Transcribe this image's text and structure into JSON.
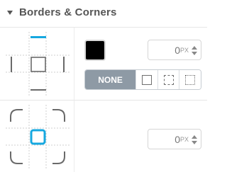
{
  "panel": {
    "title": "Borders & Corners"
  },
  "borders": {
    "color_swatch": "#000000",
    "width": {
      "value": "0",
      "unit": "PX"
    },
    "styles": [
      {
        "label": "NONE",
        "selected": true
      },
      {
        "icon": "solid-border-icon"
      },
      {
        "icon": "dashed-border-icon"
      },
      {
        "icon": "dotted-border-icon"
      }
    ],
    "active_side": "top",
    "accent_color": "#16a8e0"
  },
  "corners": {
    "radius": {
      "value": "0",
      "unit": "PX"
    },
    "accent_color": "#16a8e0"
  }
}
